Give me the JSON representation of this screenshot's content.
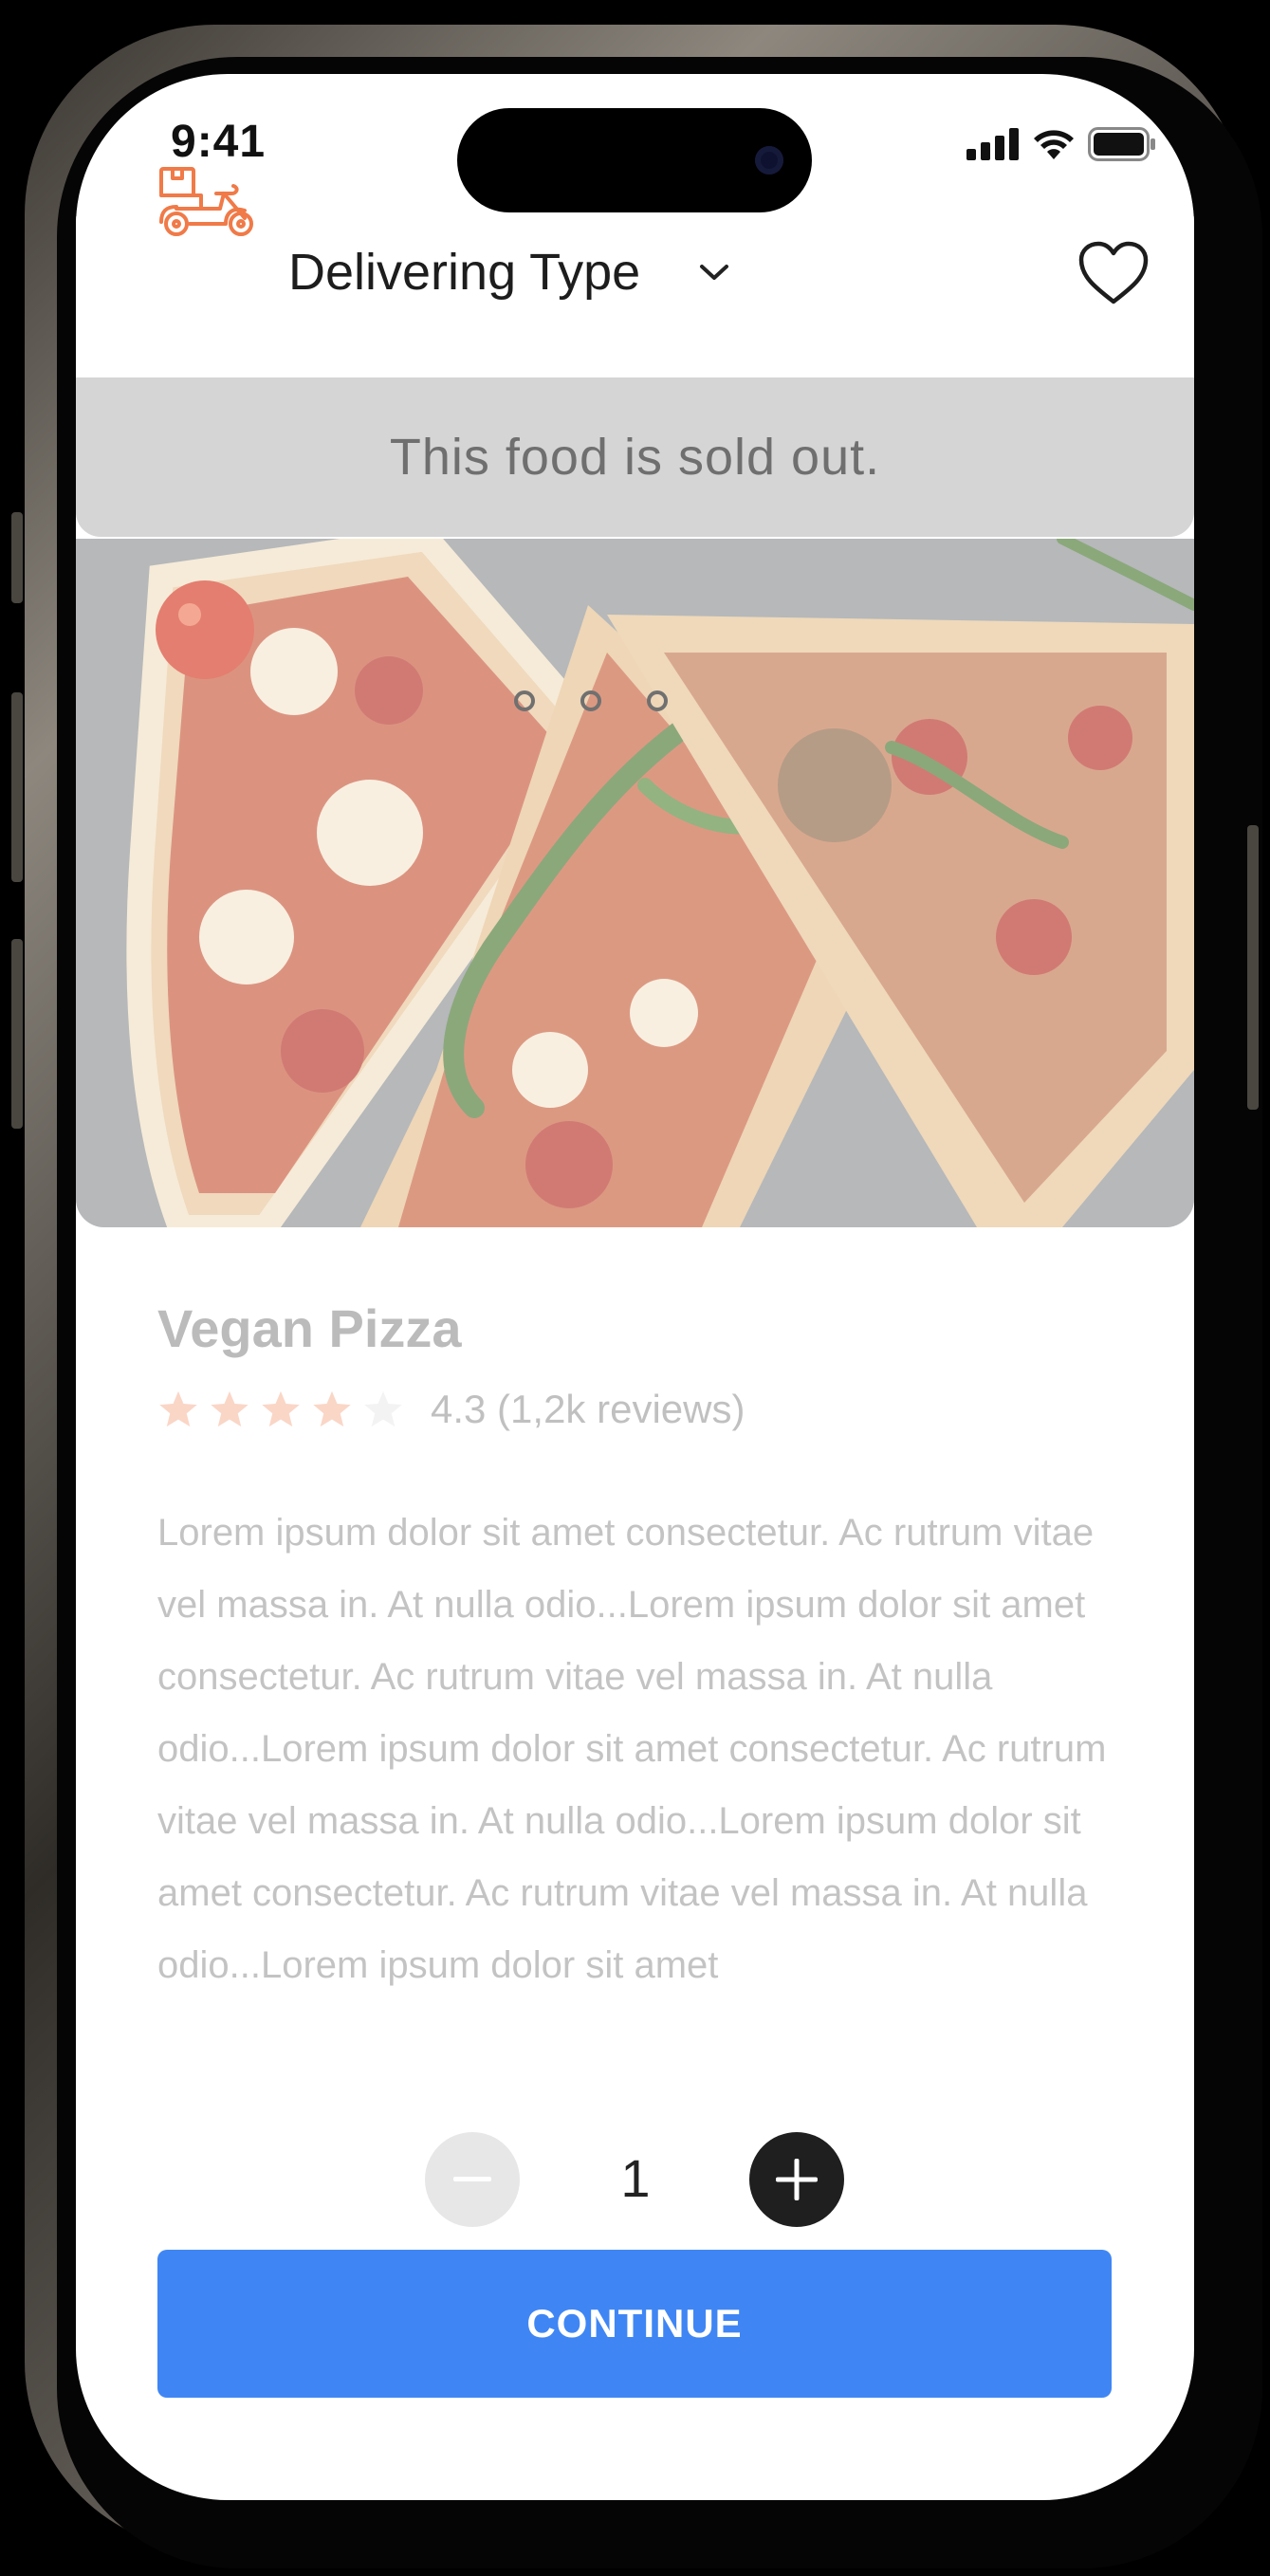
{
  "status_bar": {
    "time": "9:41"
  },
  "header": {
    "title": "Delivering Type"
  },
  "banner": {
    "message": "This food is sold out."
  },
  "product": {
    "name": "Vegan Pizza",
    "rating": 4.3,
    "max_rating": 5,
    "rating_text": "4.3 (1,2k reviews)",
    "description": "Lorem ipsum dolor sit amet consectetur. Ac rutrum vitae vel massa in. At nulla odio...Lorem ipsum dolor sit amet consectetur. Ac rutrum vitae vel massa in. At nulla odio...Lorem ipsum dolor sit amet consectetur. Ac rutrum vitae vel massa in. At nulla odio...Lorem ipsum dolor sit amet consectetur. Ac rutrum vitae vel massa in. At nulla odio...Lorem ipsum dolor sit amet"
  },
  "quantity": {
    "value": "1"
  },
  "actions": {
    "continue_label": "CONTINUE"
  },
  "colors": {
    "accent": "#3f86f4",
    "brand_orange": "#f07a48",
    "star": "#f07a48"
  },
  "icons": {
    "header_left": "delivery-scooter-icon",
    "header_right": "heart-icon",
    "dropdown": "chevron-down-icon"
  }
}
